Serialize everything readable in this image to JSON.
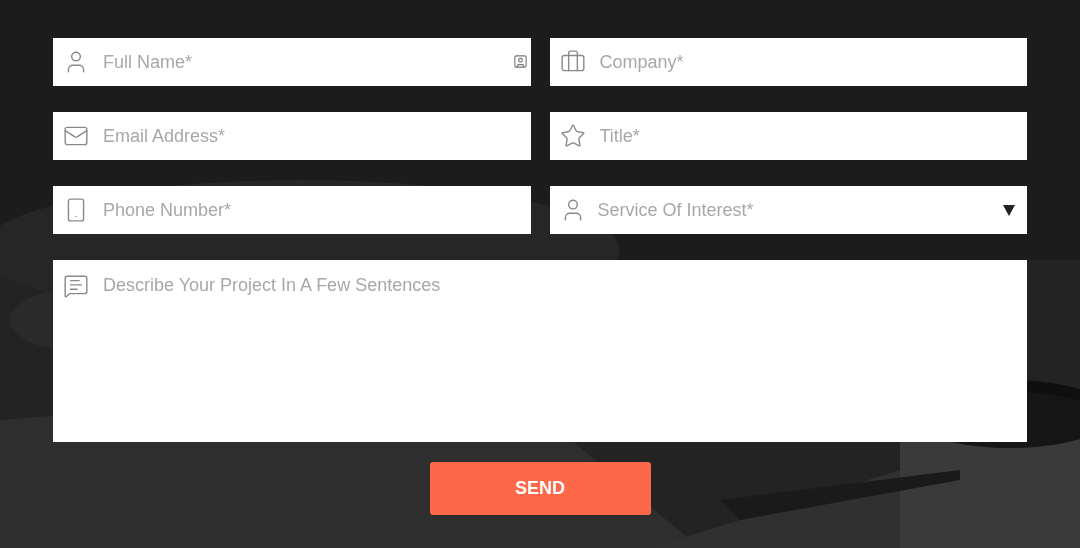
{
  "fields": [
    {
      "kind": "text",
      "placeholder": "Full Name*",
      "autofill": true
    },
    {
      "kind": "text",
      "placeholder": "Company*",
      "autofill": false
    },
    {
      "kind": "text",
      "placeholder": "Email Address*",
      "autofill": false
    },
    {
      "kind": "text",
      "placeholder": "Title*",
      "autofill": false
    },
    {
      "kind": "text",
      "placeholder": "Phone Number*",
      "autofill": false
    },
    {
      "kind": "select",
      "placeholder": "Service Of Interest*"
    }
  ],
  "message": {
    "placeholder": "Describe Your Project In A Few Sentences"
  },
  "submit": {
    "label": "SEND"
  }
}
